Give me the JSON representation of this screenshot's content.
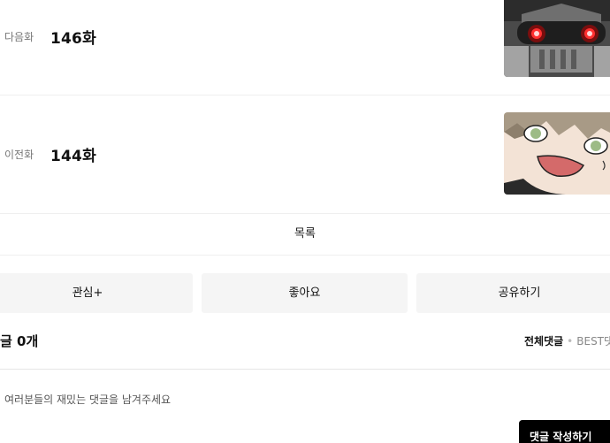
{
  "next_episode": {
    "kind": "다음화",
    "title": "146화"
  },
  "prev_episode": {
    "kind": "이전화",
    "title": "144화"
  },
  "list_label": "목록",
  "actions": {
    "subscribe": "관심+",
    "like": "좋아요",
    "share": "공유하기"
  },
  "comments": {
    "count_label": "글 0개",
    "sort_all": "전체댓글",
    "sort_separator": "•",
    "sort_best": "BEST댓",
    "placeholder": "여러분들의 재밌는 댓글을 남겨주세요",
    "write_button": "댓글 작성하기"
  }
}
